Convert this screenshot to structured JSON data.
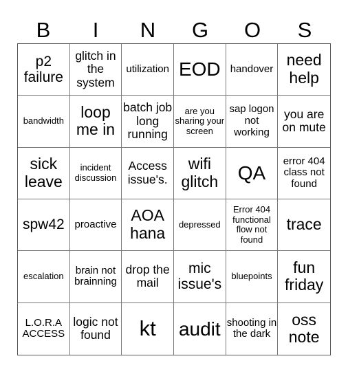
{
  "header": [
    "B",
    "I",
    "N",
    "G",
    "O",
    "S"
  ],
  "cells": [
    [
      "p2 failure",
      "glitch in the system",
      "utilization",
      "EOD",
      "handover",
      "need help"
    ],
    [
      "bandwidth",
      "loop me in",
      "batch job long running",
      "are you sharing your screen",
      "sap logon not working",
      "you are on mute"
    ],
    [
      "sick leave",
      "incident discussion",
      "Access issue's.",
      "wifi glitch",
      "QA",
      "error 404 class not found"
    ],
    [
      "spw42",
      "proactive",
      "AOA hana",
      "depressed",
      "Error 404 functional flow not found",
      "trace"
    ],
    [
      "escalation",
      "brain not brainning",
      "drop the mail",
      "mic issue's",
      "bluepoints",
      "fun friday"
    ],
    [
      "L.O.R.A ACCESS",
      "logic not found",
      "kt",
      "audit",
      "shooting in the dark",
      "oss note"
    ]
  ]
}
